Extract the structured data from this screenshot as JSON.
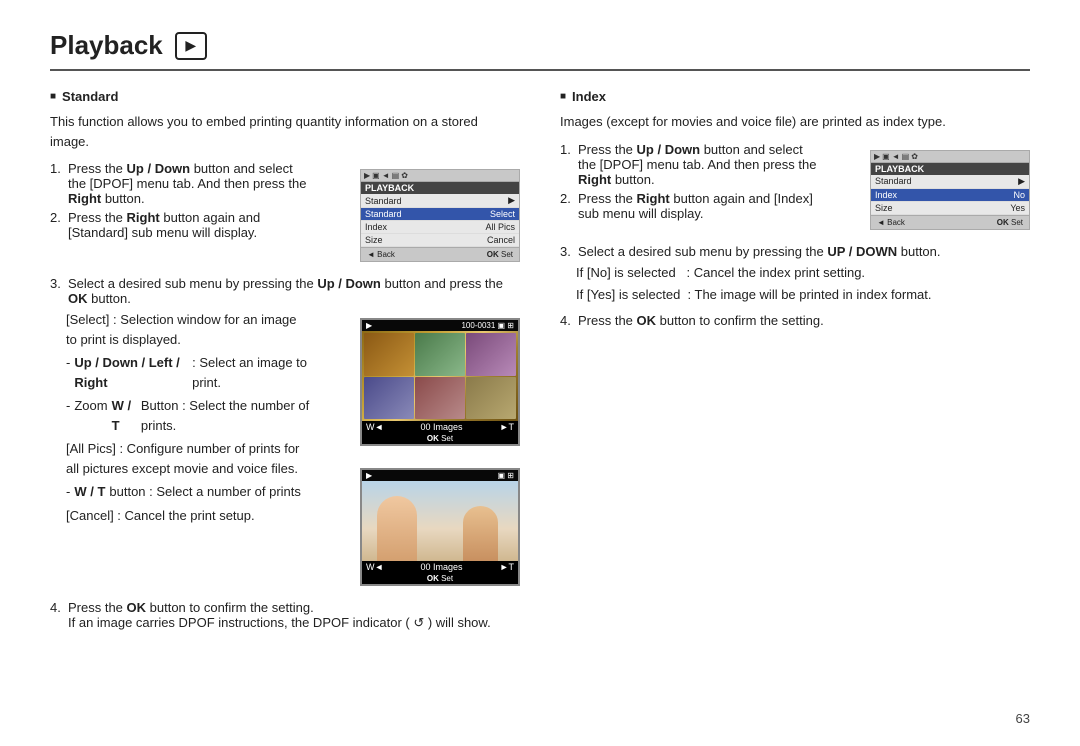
{
  "title": "Playback",
  "left_section": {
    "header": "Standard",
    "intro": "This function allows you to embed printing quantity information on a stored image.",
    "steps": [
      {
        "id": 1,
        "text_parts": [
          {
            "text": "Press the ",
            "bold": false
          },
          {
            "text": "Up / Down",
            "bold": true
          },
          {
            "text": " button and select the [DPOF] menu tab. And then press the ",
            "bold": false
          },
          {
            "text": "Right",
            "bold": true
          },
          {
            "text": " button.",
            "bold": false
          }
        ]
      },
      {
        "id": 2,
        "text_parts": [
          {
            "text": "Press the ",
            "bold": false
          },
          {
            "text": "Right",
            "bold": true
          },
          {
            "text": " button again and [Standard] sub menu will display.",
            "bold": false
          }
        ]
      },
      {
        "id": 3,
        "text_parts": [
          {
            "text": "Select a desired sub menu by pressing the ",
            "bold": false
          },
          {
            "text": "Up / Down",
            "bold": true
          },
          {
            "text": " button and press the ",
            "bold": false
          },
          {
            "text": "OK",
            "bold": true
          },
          {
            "text": " button.",
            "bold": false
          }
        ]
      }
    ],
    "bracket_items": [
      "[Select] : Selection window for an image to print is displayed."
    ],
    "dash_items": [
      {
        "text_parts": [
          {
            "text": "Up / Down / Left / Right",
            "bold": true
          },
          {
            "text": " : Select an image to print.",
            "bold": false
          }
        ]
      },
      {
        "text_parts": [
          {
            "text": "Zoom ",
            "bold": false
          },
          {
            "text": "W / T",
            "bold": true
          },
          {
            "text": " Button : Select the number of prints.",
            "bold": false
          }
        ]
      }
    ],
    "bracket_items2": [
      "[All Pics] : Configure number of prints for all pictures except movie and voice files."
    ],
    "dash_items2": [
      {
        "text_parts": [
          {
            "text": "W / T",
            "bold": true
          },
          {
            "text": " button : Select a number of prints",
            "bold": false
          }
        ]
      }
    ],
    "bracket_items3": [
      "[Cancel] : Cancel the print setup."
    ],
    "step4": {
      "text_parts": [
        {
          "text": "Press the ",
          "bold": false
        },
        {
          "text": "OK",
          "bold": true
        },
        {
          "text": " button to confirm the setting.",
          "bold": false
        }
      ],
      "sub_text": "If an image carries DPOF instructions, the DPOF indicator (  ) will show."
    }
  },
  "right_section": {
    "header": "Index",
    "intro": "Images (except for movies and voice file) are printed as index type.",
    "steps": [
      {
        "id": 1,
        "text_parts": [
          {
            "text": "Press the ",
            "bold": false
          },
          {
            "text": "Up / Down",
            "bold": true
          },
          {
            "text": " button and select the [DPOF] menu tab. And then press the ",
            "bold": false
          },
          {
            "text": "Right",
            "bold": true
          },
          {
            "text": " button.",
            "bold": false
          }
        ]
      },
      {
        "id": 2,
        "text_parts": [
          {
            "text": "Press the ",
            "bold": false
          },
          {
            "text": "Right",
            "bold": true
          },
          {
            "text": " button again and [Index] sub menu will display.",
            "bold": false
          }
        ]
      },
      {
        "id": 3,
        "text_parts": [
          {
            "text": "Select a desired sub menu by pressing the ",
            "bold": false
          },
          {
            "text": "UP / DOWN",
            "bold": true
          },
          {
            "text": " button.",
            "bold": false
          }
        ]
      }
    ],
    "if_items": [
      "If [No] is selected   : Cancel the index print setting.",
      "If [Yes] is selected  : The image will be printed in index format."
    ],
    "step4": {
      "text_parts": [
        {
          "text": "Press the ",
          "bold": false
        },
        {
          "text": "OK",
          "bold": true
        },
        {
          "text": " button to confirm the setting.",
          "bold": false
        }
      ]
    }
  },
  "menu_screen_left": {
    "icons": [
      "▶",
      "▣",
      "◄",
      "▤",
      "✿"
    ],
    "section": "PLAYBACK",
    "rows": [
      {
        "label": "Standard",
        "value": "Select",
        "selected": true
      },
      {
        "label": "Index",
        "value": "All Pics",
        "selected": false
      },
      {
        "label": "Size",
        "value": "Cancel",
        "selected": false
      }
    ],
    "bottom_left": "◄ Back",
    "bottom_right": "OK Set"
  },
  "menu_screen_right": {
    "icons": [
      "▶",
      "▣",
      "◄",
      "▤",
      "✿"
    ],
    "section": "PLAYBACK",
    "rows": [
      {
        "label": "Standard",
        "value": "▶",
        "selected": false
      },
      {
        "label": "Index",
        "value": "No",
        "selected": true
      },
      {
        "label": "Size",
        "value": "Yes",
        "selected": false
      }
    ],
    "bottom_left": "◄ Back",
    "bottom_right": "OK Set"
  },
  "preview_screen1": {
    "top_left": "▶",
    "top_right": "100-0031 ▣ ⊞",
    "w_label": "W◄",
    "images_label": "00 Images",
    "t_label": "►T",
    "ok_label": "OK Set"
  },
  "preview_screen2": {
    "top_left": "▶",
    "top_right": "▣ ⊞",
    "w_label": "W◄",
    "images_label": "00 Images",
    "t_label": "►T",
    "ok_label": "OK Set"
  },
  "page_number": "63"
}
